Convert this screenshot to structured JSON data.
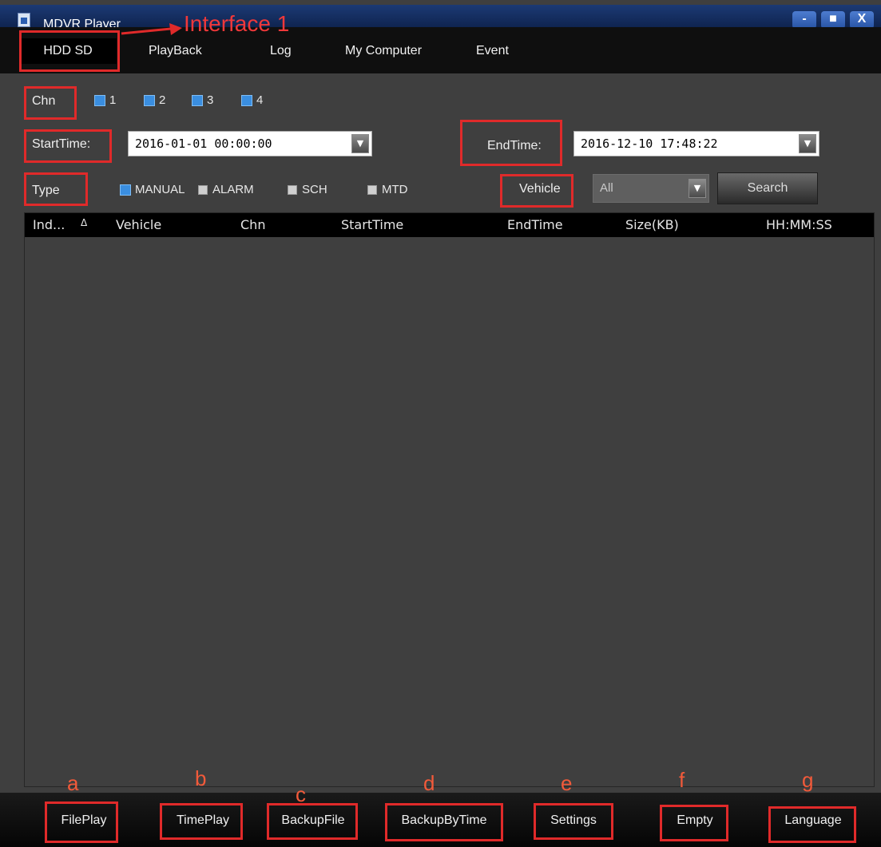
{
  "window": {
    "title": "MDVR Player",
    "controls": {
      "minimize": "-",
      "maximize": "■",
      "close": "X"
    }
  },
  "nav": {
    "tabs": [
      {
        "label": "HDD SD",
        "active": true
      },
      {
        "label": "PlayBack"
      },
      {
        "label": "Log"
      },
      {
        "label": "My Computer"
      },
      {
        "label": "Event"
      }
    ]
  },
  "filters": {
    "chn_label": "Chn",
    "channels": [
      "1",
      "2",
      "3",
      "4"
    ],
    "start_label": "StartTime:",
    "start_value": "2016-01-01 00:00:00",
    "end_label": "EndTime:",
    "end_value": "2016-12-10 17:48:22",
    "type_label": "Type",
    "types": [
      {
        "label": "MANUAL",
        "checked": true
      },
      {
        "label": "ALARM",
        "checked": false
      },
      {
        "label": "SCH",
        "checked": false
      },
      {
        "label": "MTD",
        "checked": false
      }
    ],
    "vehicle_label": "Vehicle",
    "vehicle_value": "All",
    "search_label": "Search"
  },
  "table": {
    "columns": [
      "Ind...",
      "Vehicle",
      "Chn",
      "StartTime",
      "EndTime",
      "Size(KB)",
      "HH:MM:SS"
    ],
    "sort_indicator": "Δ",
    "rows": []
  },
  "bottom": {
    "buttons": [
      "FilePlay",
      "TimePlay",
      "BackupFile",
      "BackupByTime",
      "Settings",
      "Empty",
      "Language"
    ]
  },
  "annotations": {
    "interface_label": "Interface 1",
    "letters": [
      "a",
      "b",
      "c",
      "d",
      "e",
      "f",
      "g"
    ],
    "color": "#e02a2a"
  },
  "colors": {
    "background": "#3f3f3f",
    "titlebar": "#1c3a74",
    "checkbox_checked": "#3a8ee0"
  }
}
